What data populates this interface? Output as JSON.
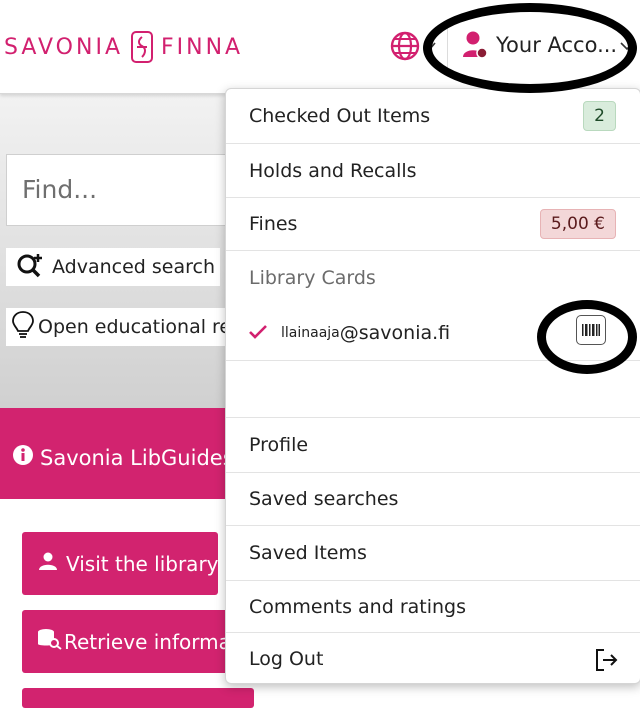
{
  "header": {
    "logo_left": "SAVONIA",
    "logo_right": "FINNA",
    "account_label": "Your Acco...",
    "accent_color": "#d2206f"
  },
  "background": {
    "search_placeholder": "Find...",
    "advanced_search": "Advanced search",
    "oer_link": "Open educational re",
    "libguides": "Savonia LibGuides",
    "visit_library": "Visit the library",
    "retrieve_info": "Retrieve informat"
  },
  "account_menu": {
    "checked_out": {
      "label": "Checked Out Items",
      "count": "2"
    },
    "holds": {
      "label": "Holds and Recalls"
    },
    "fines": {
      "label": "Fines",
      "amount": "5,00 €"
    },
    "library_cards_header": "Library Cards",
    "card": {
      "prefix": "llainaaja",
      "suffix": "@savonia.fi",
      "selected": true
    },
    "profile": "Profile",
    "saved_searches": "Saved searches",
    "saved_items": "Saved Items",
    "comments": "Comments and ratings",
    "logout": "Log Out"
  },
  "icons": {
    "globe": "globe-icon",
    "user": "user-icon",
    "barcode": "barcode-icon",
    "logout": "logout-icon",
    "check": "check-icon"
  }
}
